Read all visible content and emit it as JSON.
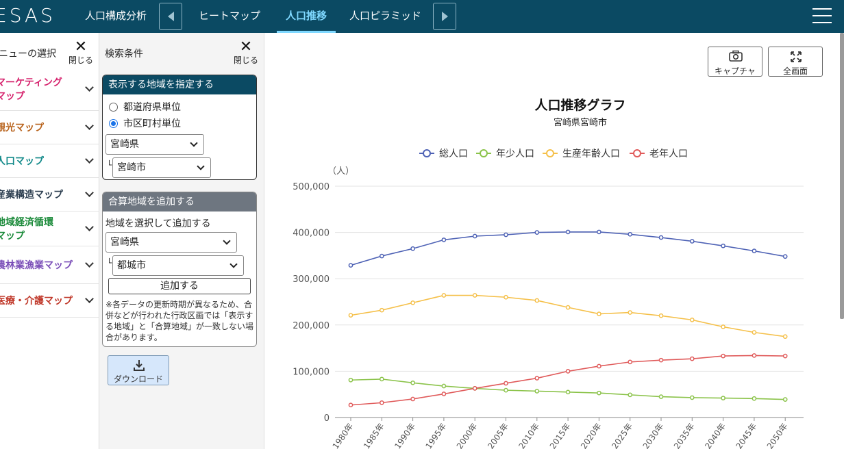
{
  "header": {
    "logo": "ESAS",
    "nav": {
      "composition": "人口構成分析",
      "heatmap": "ヒートマップ",
      "trend": "人口推移",
      "pyramid": "人口ピラミッド"
    }
  },
  "menu_panel": {
    "title": "ニューの選択",
    "close_label": "閉じる",
    "items": [
      {
        "label": "マーケティング\nマップ",
        "color": "#d6246e"
      },
      {
        "label": "観光マップ",
        "color": "#b8621b"
      },
      {
        "label": "人口マップ",
        "color": "#138a8a"
      },
      {
        "label": "産業構造マップ",
        "color": "#2c3e50"
      },
      {
        "label": "地域経済循環\nマップ",
        "color": "#1b8a3a"
      },
      {
        "label": "農林業漁業マップ",
        "color": "#7b4fb8"
      },
      {
        "label": "医療・介護マップ",
        "color": "#c0392b"
      }
    ]
  },
  "search_panel": {
    "title": "検索条件",
    "close_label": "閉じる",
    "region_box": {
      "heading": "表示する地域を指定する",
      "heading_color": "#0b4a63",
      "radio_prefecture": "都道府県単位",
      "radio_city": "市区町村単位",
      "prefecture": "宮崎県",
      "tree_mark": "└",
      "city": "宮崎市"
    },
    "add_box": {
      "heading": "合算地域を追加する",
      "heading_color": "#6e7680",
      "instruction": "地域を選択して追加する",
      "prefecture": "宮崎県",
      "tree_mark": "└",
      "city": "都城市",
      "add_button": "追加する",
      "note": "※各データの更新時期が異なるため、合併などが行われた行政区画では「表示する地域」と「合算地域」が一致しない場合があります。"
    },
    "download_label": "ダウンロード"
  },
  "chart_tools": {
    "capture": "キャプチャ",
    "fullscreen": "全画面"
  },
  "chart_data": {
    "type": "line",
    "title": "人口推移グラフ",
    "subtitle": "宮崎県宮崎市",
    "ylabel": "（人）",
    "ylim": [
      0,
      500000
    ],
    "yticks": [
      0,
      100000,
      200000,
      300000,
      400000,
      500000
    ],
    "ytick_labels": [
      "0",
      "100,000",
      "200,000",
      "300,000",
      "400,000",
      "500,000"
    ],
    "grid": true,
    "legend": "top-center",
    "categories": [
      "1980年",
      "1985年",
      "1990年",
      "1995年",
      "2000年",
      "2005年",
      "2010年",
      "2015年",
      "2020年",
      "2025年",
      "2030年",
      "2035年",
      "2040年",
      "2045年",
      "2050年"
    ],
    "series": [
      {
        "name": "総人口",
        "color": "#4e62b5",
        "values": [
          329000,
          349000,
          365000,
          384000,
          392000,
          395000,
          400000,
          401000,
          401000,
          396000,
          389000,
          381000,
          371000,
          360000,
          348000
        ]
      },
      {
        "name": "年少人口",
        "color": "#8bc34a",
        "values": [
          81000,
          83000,
          75000,
          68000,
          63000,
          59000,
          57000,
          55000,
          53000,
          49000,
          45000,
          43000,
          42000,
          41000,
          39000
        ]
      },
      {
        "name": "生産年齢人口",
        "color": "#f5c04a",
        "values": [
          221000,
          232000,
          248000,
          264000,
          264000,
          260000,
          253000,
          238000,
          224000,
          227000,
          220000,
          211000,
          196000,
          184000,
          175000
        ]
      },
      {
        "name": "老年人口",
        "color": "#e05a5a",
        "values": [
          27000,
          32000,
          40000,
          51000,
          63000,
          74000,
          85000,
          100000,
          111000,
          120000,
          124000,
          127000,
          133000,
          134000,
          133000
        ]
      }
    ]
  }
}
